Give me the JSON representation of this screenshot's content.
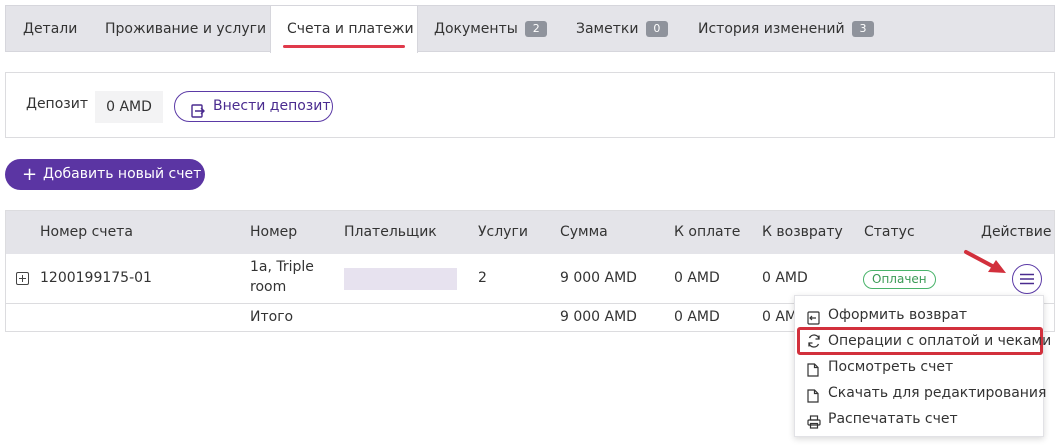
{
  "tabs": [
    {
      "label": "Детали"
    },
    {
      "label": "Проживание и услуги"
    },
    {
      "label": "Счета и платежи"
    },
    {
      "label": "Документы",
      "badge": "2"
    },
    {
      "label": "Заметки",
      "badge": "0"
    },
    {
      "label": "История изменений",
      "badge": "3"
    }
  ],
  "deposit": {
    "label": "Депозит",
    "value": "0 AMD",
    "button": "Внести депозит"
  },
  "add_invoice": {
    "label": "Добавить новый счет"
  },
  "table": {
    "headers": [
      "Номер счета",
      "Номер",
      "Плательщик",
      "Услуги",
      "Сумма",
      "К оплате",
      "К возврату",
      "Статус",
      "Действие"
    ],
    "row": {
      "invoice": "1200199175-01",
      "room_line1": "1a, Triple",
      "room_line2": "room",
      "services": "2",
      "sum": "9 000 AMD",
      "to_pay": "0 AMD",
      "refund": "0 AMD",
      "status": "Оплачен"
    },
    "total": {
      "label": "Итого",
      "sum": "9 000 AMD",
      "to_pay": "0 AMD",
      "refund": "0 AM"
    }
  },
  "menu": [
    {
      "label": "Оформить возврат",
      "icon": "refund-icon"
    },
    {
      "label": "Операции с оплатой и чеками",
      "icon": "sync-icon"
    },
    {
      "label": "Посмотреть счет",
      "icon": "document-icon"
    },
    {
      "label": "Скачать для редактирования",
      "icon": "document-icon"
    },
    {
      "label": "Распечатать счет",
      "icon": "printer-icon"
    }
  ],
  "colors": {
    "accent": "#5b35a3",
    "highlight": "#d2303c",
    "status_green": "#3a9a55"
  }
}
